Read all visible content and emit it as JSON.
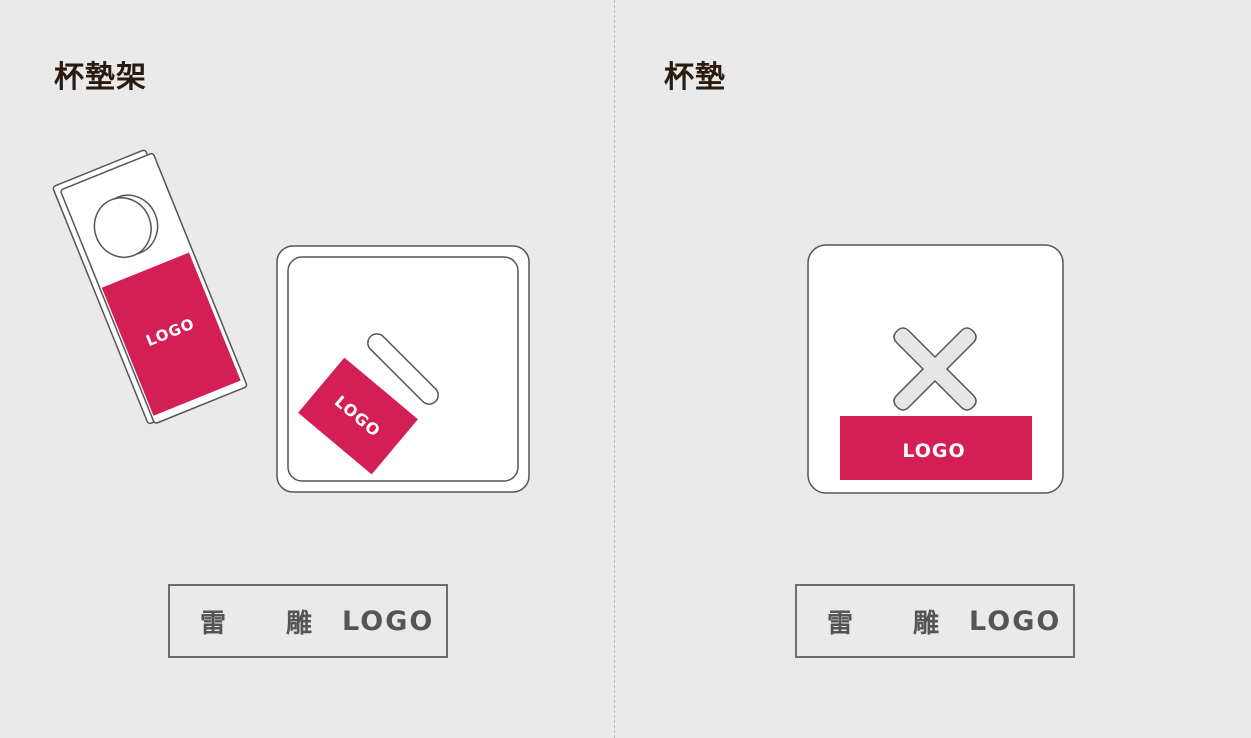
{
  "panels": {
    "left": {
      "title": "杯墊架"
    },
    "right": {
      "title": "杯墊"
    }
  },
  "logo_mark": "LOGO",
  "labels": {
    "left": {
      "char1": "雷",
      "char2": "雕",
      "logo": "LOGO"
    },
    "right": {
      "char1": "雷",
      "char2": "雕",
      "logo": "LOGO"
    }
  },
  "colors": {
    "background": "#eaeaea",
    "logo_fill": "#d31f56",
    "outline": "#555555",
    "x_mark_fill": "#e6e6e6"
  }
}
